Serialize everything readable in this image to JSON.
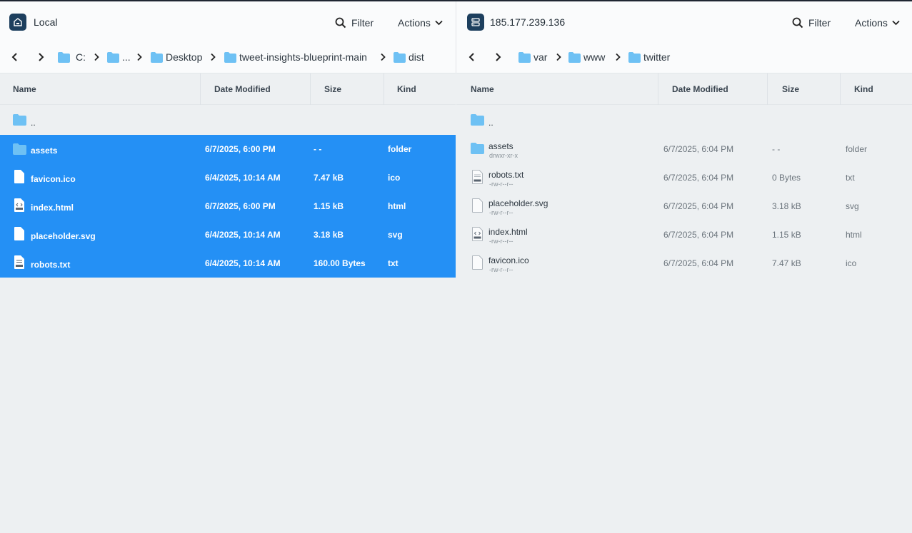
{
  "left": {
    "title": "Local",
    "filter_label": "Filter",
    "actions_label": "Actions",
    "breadcrumb": [
      "C:",
      "...",
      "Desktop",
      "tweet-insights-blueprint-main",
      "dist"
    ],
    "columns": {
      "name": "Name",
      "date": "Date Modified",
      "size": "Size",
      "kind": "Kind"
    },
    "parent": "..",
    "rows": [
      {
        "name": "assets",
        "date": "6/7/2025, 6:00 PM",
        "size": "- -",
        "kind": "folder",
        "icon": "folder-icon"
      },
      {
        "name": "favicon.ico",
        "date": "6/4/2025, 10:14 AM",
        "size": "7.47 kB",
        "kind": "ico",
        "icon": "file-icon"
      },
      {
        "name": "index.html",
        "date": "6/7/2025, 6:00 PM",
        "size": "1.15 kB",
        "kind": "html",
        "icon": "html-file-icon"
      },
      {
        "name": "placeholder.svg",
        "date": "6/4/2025, 10:14 AM",
        "size": "3.18 kB",
        "kind": "svg",
        "icon": "file-icon"
      },
      {
        "name": "robots.txt",
        "date": "6/4/2025, 10:14 AM",
        "size": "160.00 Bytes",
        "kind": "txt",
        "icon": "txt-file-icon"
      }
    ]
  },
  "right": {
    "title": "185.177.239.136",
    "filter_label": "Filter",
    "actions_label": "Actions",
    "breadcrumb": [
      "var",
      "www",
      "twitter"
    ],
    "columns": {
      "name": "Name",
      "date": "Date Modified",
      "size": "Size",
      "kind": "Kind"
    },
    "parent": "..",
    "rows": [
      {
        "name": "assets",
        "perm": "drwxr-xr-x",
        "date": "6/7/2025, 6:04 PM",
        "size": "- -",
        "kind": "folder",
        "icon": "folder-icon"
      },
      {
        "name": "robots.txt",
        "perm": "-rw-r--r--",
        "date": "6/7/2025, 6:04 PM",
        "size": "0 Bytes",
        "kind": "txt",
        "icon": "txt-file-icon"
      },
      {
        "name": "placeholder.svg",
        "perm": "-rw-r--r--",
        "date": "6/7/2025, 6:04 PM",
        "size": "3.18 kB",
        "kind": "svg",
        "icon": "file-icon"
      },
      {
        "name": "index.html",
        "perm": "-rw-r--r--",
        "date": "6/7/2025, 6:04 PM",
        "size": "1.15 kB",
        "kind": "html",
        "icon": "html-file-icon"
      },
      {
        "name": "favicon.ico",
        "perm": "-rw-r--r--",
        "date": "6/7/2025, 6:04 PM",
        "size": "7.47 kB",
        "kind": "ico",
        "icon": "file-icon"
      }
    ]
  },
  "colors": {
    "selection": "#2490f5",
    "folder": "#6ec1f4",
    "location_icon_bg": "#1d3f5e",
    "header_bg": "#fafbfc",
    "body_bg": "#edf0f2"
  }
}
